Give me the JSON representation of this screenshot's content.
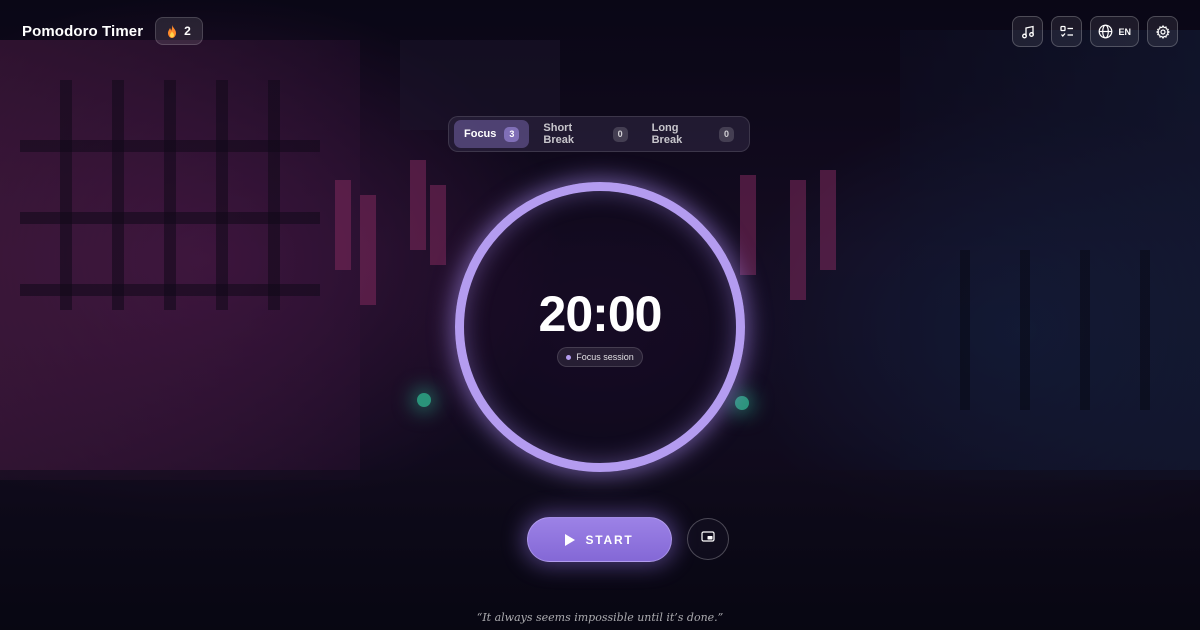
{
  "header": {
    "app_title": "Pomodoro Timer",
    "streak_count": "2",
    "streak_icon": "flame-icon",
    "language_code": "EN",
    "icons": [
      "music-icon",
      "tasks-icon",
      "globe-icon",
      "gear-icon"
    ]
  },
  "mode_tabs": [
    {
      "label": "Focus",
      "count": "3",
      "active": true
    },
    {
      "label": "Short Break",
      "count": "0",
      "active": false
    },
    {
      "label": "Long Break",
      "count": "0",
      "active": false
    }
  ],
  "timer": {
    "time": "20:00",
    "session_label": "Focus session",
    "progress": 1.0
  },
  "controls": {
    "start_label": "START",
    "pip_icon": "picture-in-picture-icon"
  },
  "quote": "“It always seems impossible until it’s done.”",
  "colors": {
    "accent": "#b49cf0",
    "button": "#9075df",
    "background": "#0d0a1c"
  }
}
